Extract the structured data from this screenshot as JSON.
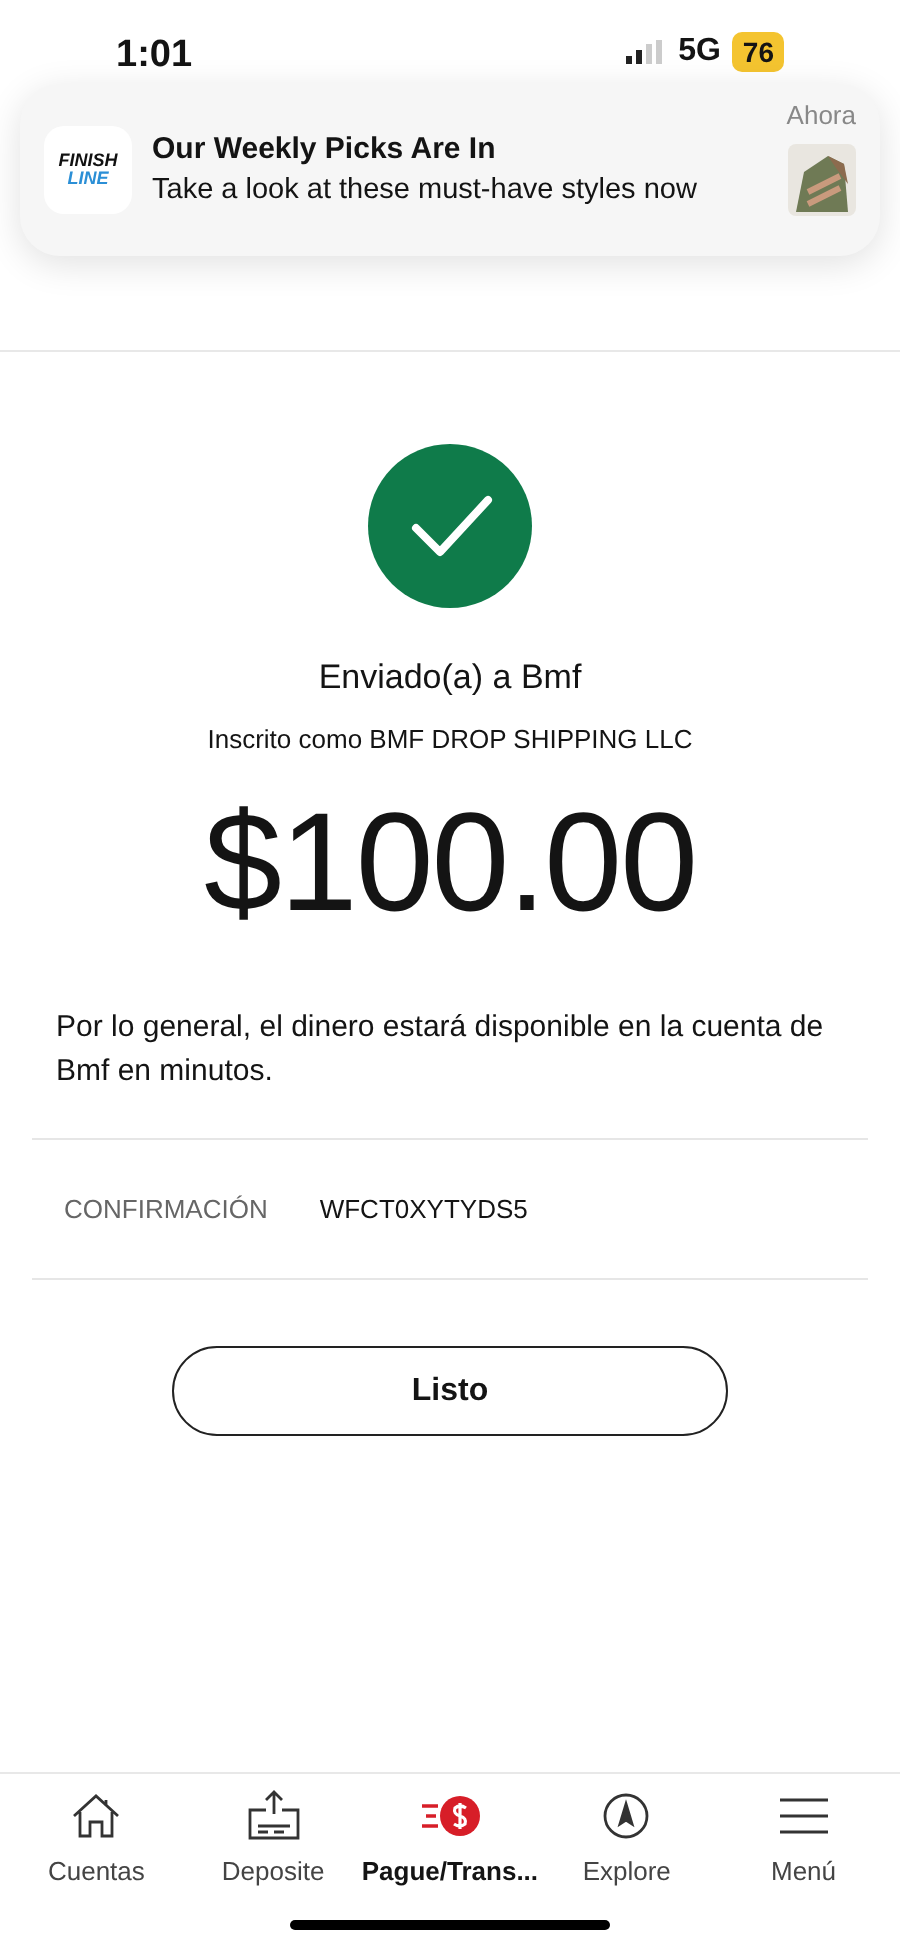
{
  "status_bar": {
    "time": "1:01",
    "network": "5G",
    "battery": "76"
  },
  "notification": {
    "app_logo": [
      "FINISH",
      "LINE"
    ],
    "title": "Our Weekly Picks Are In",
    "body": "Take a look at these must-have styles now",
    "time": "Ahora"
  },
  "confirmation": {
    "recipient_line": "Enviado(a) a Bmf",
    "enrolled_as": "Inscrito como BMF DROP SHIPPING LLC",
    "amount": "$100.00",
    "message": "Por lo general, el dinero estará disponible en la cuenta de Bmf en minutos.",
    "details": [
      {
        "label": "CONFIRMACIÓN",
        "value": "WFCT0XYTYDS5"
      }
    ],
    "done_button": "Listo"
  },
  "bottom_nav": [
    {
      "kind": "home",
      "label": "Cuentas",
      "selected": false
    },
    {
      "kind": "deposit",
      "label": "Deposite",
      "selected": false
    },
    {
      "kind": "pay",
      "label": "Pague/Trans...",
      "selected": true
    },
    {
      "kind": "explore",
      "label": "Explore",
      "selected": false
    },
    {
      "kind": "menu",
      "label": "Menú",
      "selected": false
    }
  ]
}
